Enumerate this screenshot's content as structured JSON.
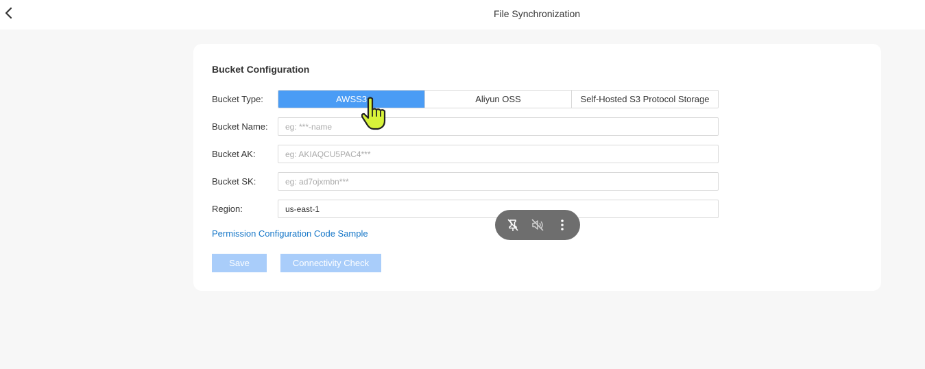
{
  "header": {
    "title": "File Synchronization",
    "back_icon": "chevron-left-icon"
  },
  "bucket_config": {
    "section_title": "Bucket Configuration",
    "type_label": "Bucket Type:",
    "types": [
      "AWSS3",
      "Aliyun OSS",
      "Self-Hosted S3 Protocol Storage"
    ],
    "selected_type": "AWSS3",
    "name_label": "Bucket Name:",
    "name_placeholder": "eg: ***-name",
    "name_value": "",
    "ak_label": "Bucket AK:",
    "ak_placeholder": "eg: AKIAQCU5PAC4***",
    "ak_value": "",
    "sk_label": "Bucket SK:",
    "sk_placeholder": "eg: ad7ojxmbn***",
    "sk_value": "",
    "region_label": "Region:",
    "region_placeholder": "",
    "region_value": "us-east-1",
    "permission_link": "Permission Configuration Code Sample",
    "save_label": "Save",
    "check_label": "Connectivity Check"
  },
  "media_controls": {
    "icons": [
      "unpin-icon",
      "mute-icon",
      "more-vertical-icon"
    ],
    "background": "#6e6e6e"
  },
  "colors": {
    "accent": "#4a9cf5",
    "disabled_button": "#a9cdfa",
    "link": "#1677c8"
  }
}
